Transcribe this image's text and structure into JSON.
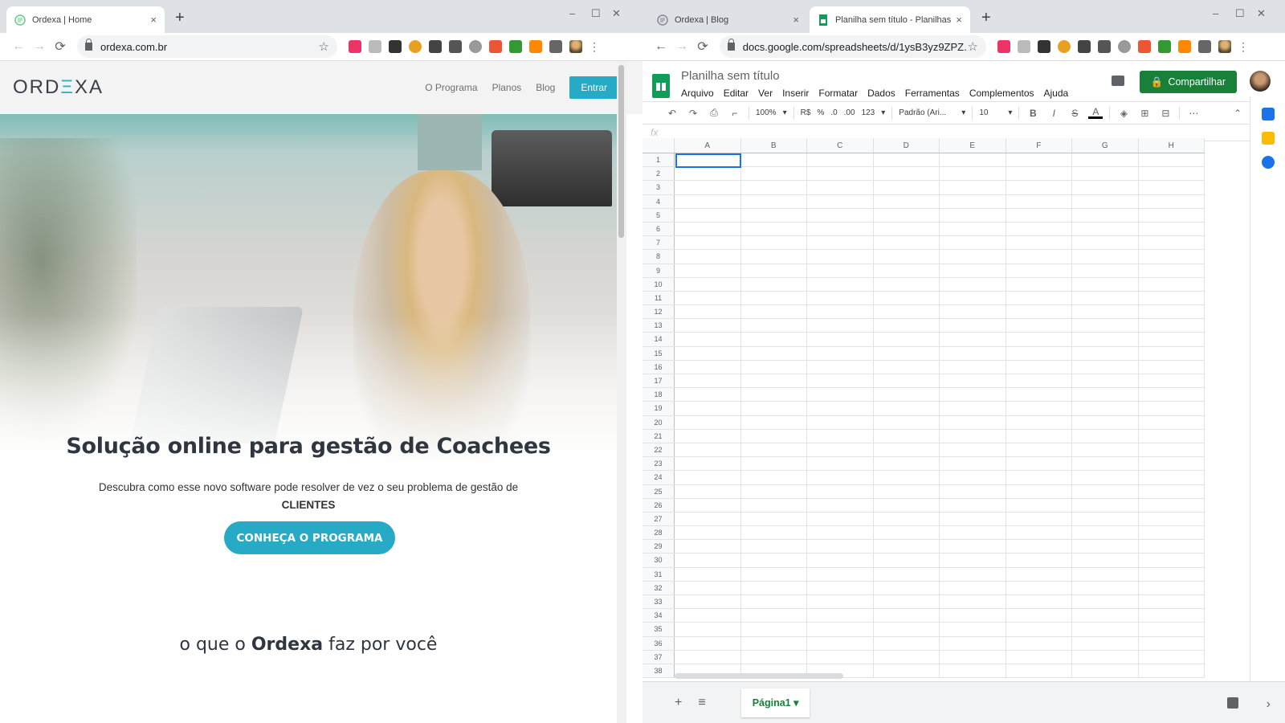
{
  "left_window": {
    "tab": {
      "title": "Ordexa | Home",
      "close": "×"
    },
    "new_tab": "+",
    "controls": {
      "minimize": "–",
      "maximize": "☐",
      "close": "✕"
    },
    "nav": {
      "back": "←",
      "forward": "→",
      "reload": "⟳"
    },
    "url": "ordexa.com.br",
    "star": "☆",
    "menu": "⋮",
    "site": {
      "logo_a": "ORD",
      "logo_b": "Ξ",
      "logo_c": "XA",
      "nav_items": [
        "O Programa",
        "Planos",
        "Blog"
      ],
      "login_button": "Entrar",
      "hero_title": "Solução online para gestão de Coachees",
      "hero_sub_text": "Descubra como esse novo software pode resolver de vez o seu problema de gestão de ",
      "hero_sub_bold": "CLIENTES",
      "cta": "CONHEÇA O PROGRAMA",
      "section_prefix": "o que o ",
      "section_bold": "Ordexa",
      "section_suffix": " faz por você"
    }
  },
  "right_window": {
    "tabs": [
      {
        "title": "Ordexa | Blog",
        "close": "×"
      },
      {
        "title": "Planilha sem título - Planilhas G",
        "close": "×"
      }
    ],
    "new_tab": "+",
    "controls": {
      "minimize": "–",
      "maximize": "☐",
      "close": "✕"
    },
    "nav": {
      "back": "←",
      "forward": "→",
      "reload": "⟳"
    },
    "url": "docs.google.com/spreadsheets/d/1ysB3yz9ZPZ...",
    "star": "☆",
    "menu": "⋮",
    "sheets": {
      "title": "Planilha sem título",
      "menus": [
        "Arquivo",
        "Editar",
        "Ver",
        "Inserir",
        "Formatar",
        "Dados",
        "Ferramentas",
        "Complementos",
        "Ajuda"
      ],
      "share_button": "Compartilhar",
      "toolbar": {
        "undo": "↶",
        "redo": "↷",
        "print": "⎙",
        "paint": "⌐",
        "zoom": "100%",
        "currency": "R$",
        "percent": "%",
        "dec_less": ".0",
        "dec_more": ".00",
        "format": "123",
        "font": "Padrão (Ari...",
        "size": "10",
        "bold": "B",
        "italic": "I",
        "strike": "S",
        "color": "A",
        "more": "⋯",
        "collapse": "⌃"
      },
      "fx": "fx",
      "columns": [
        "A",
        "B",
        "C",
        "D",
        "E",
        "F",
        "G",
        "H"
      ],
      "rows": [
        "1",
        "2",
        "3",
        "4",
        "5",
        "6",
        "7",
        "8",
        "9",
        "10",
        "11",
        "12",
        "13",
        "14",
        "15",
        "16",
        "17",
        "18",
        "19",
        "20",
        "21",
        "22",
        "23",
        "24",
        "25",
        "26",
        "27",
        "28",
        "29",
        "30",
        "31",
        "32",
        "33",
        "34",
        "35",
        "36",
        "37",
        "38"
      ],
      "add_sheet": "+",
      "all_sheets": "≡",
      "sheet_tab": "Página1",
      "sheet_tab_arrow": "▾",
      "side_expand": "›"
    }
  }
}
